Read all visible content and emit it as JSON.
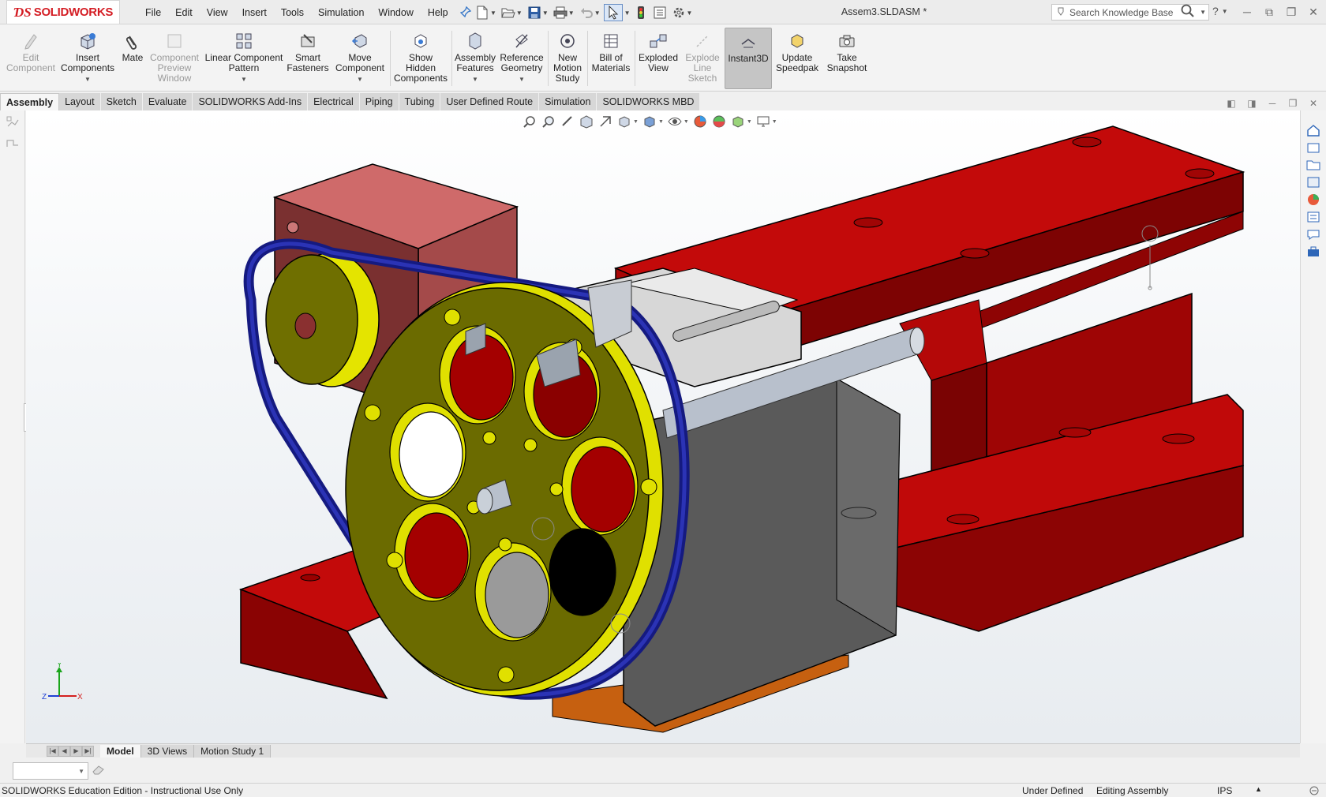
{
  "app": {
    "logo_brand": "SOLIDWORKS",
    "document_title": "Assem3.SLDASM *"
  },
  "menu": [
    "File",
    "Edit",
    "View",
    "Insert",
    "Tools",
    "Simulation",
    "Window",
    "Help"
  ],
  "search": {
    "placeholder": "Search Knowledge Base"
  },
  "ribbon": {
    "edit_component": "Edit\nComponent",
    "insert_components": "Insert\nComponents",
    "mate": "Mate",
    "component_preview": "Component\nPreview\nWindow",
    "linear_pattern": "Linear Component\nPattern",
    "smart_fasteners": "Smart\nFasteners",
    "move_component": "Move\nComponent",
    "show_hidden": "Show\nHidden\nComponents",
    "assembly_features": "Assembly\nFeatures",
    "reference_geometry": "Reference\nGeometry",
    "new_motion_study": "New\nMotion\nStudy",
    "bill_of_materials": "Bill of\nMaterials",
    "exploded_view": "Exploded\nView",
    "explode_line_sketch": "Explode\nLine\nSketch",
    "instant3d": "Instant3D",
    "update_speedpak": "Update\nSpeedpak",
    "take_snapshot": "Take\nSnapshot"
  },
  "tabs": [
    "Assembly",
    "Layout",
    "Sketch",
    "Evaluate",
    "SOLIDWORKS Add-Ins",
    "Electrical",
    "Piping",
    "Tubing",
    "User Defined Route",
    "Simulation",
    "SOLIDWORKS MBD"
  ],
  "bottom_tabs": [
    "Model",
    "3D Views",
    "Motion Study 1"
  ],
  "triad": {
    "x": "X",
    "y": "Y",
    "z": "Z"
  },
  "status": {
    "edition": "SOLIDWORKS Education Edition - Instructional Use Only",
    "definition": "Under Defined",
    "mode": "Editing Assembly",
    "units": "IPS"
  },
  "colors": {
    "frame_red": "#c20a0a",
    "motor_pink": "#c86464",
    "pulley_olive": "#6b6b00",
    "belt_blue": "#1a1f8c",
    "block_gray": "#585858",
    "accent_red": "#d41d24"
  }
}
